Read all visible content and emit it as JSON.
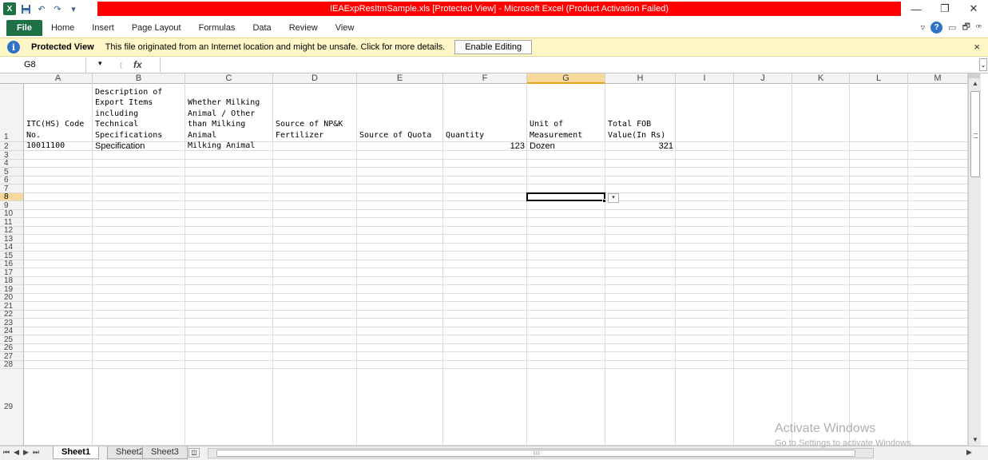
{
  "titlebar": {
    "title": "IEAExpResItmSample.xls  [Protected View]  -  Microsoft Excel (Product Activation Failed)",
    "qat_icons": [
      "excel-logo-icon",
      "save-icon",
      "undo-icon",
      "redo-icon",
      "customize-icon"
    ],
    "controls": {
      "minimize": "—",
      "restore": "❐",
      "close": "✕"
    },
    "title_bg": "#ff0000"
  },
  "ribbon": {
    "tabs": [
      "File",
      "Home",
      "Insert",
      "Page Layout",
      "Formulas",
      "Data",
      "Review",
      "View"
    ],
    "file_color": "#1e7145",
    "right": {
      "minimize_ribbon": "▿",
      "help": "?",
      "win_min": "▭",
      "win_restore": "🗗",
      "win_close": "ꟹ"
    }
  },
  "protected_view": {
    "title": "Protected View",
    "message": "This file originated from an Internet location and might be unsafe. Click for more details.",
    "enable_button": "Enable Editing",
    "close": "×",
    "bg": "#fff7c8"
  },
  "formula_bar": {
    "name_box": "G8",
    "name_arrow": "▾",
    "cancel": "(",
    "fx": "fx",
    "value": "",
    "expand": "⌄"
  },
  "columns": [
    "A",
    "B",
    "C",
    "D",
    "E",
    "F",
    "G",
    "H",
    "I",
    "J",
    "K",
    "L",
    "M"
  ],
  "selected_column": "G",
  "rows": [
    "1",
    "2",
    "3",
    "4",
    "5",
    "6",
    "7",
    "8",
    "9",
    "10",
    "11",
    "12",
    "13",
    "14",
    "15",
    "16",
    "17",
    "18",
    "19",
    "20",
    "21",
    "22",
    "23",
    "24",
    "25",
    "26",
    "27",
    "28",
    "29"
  ],
  "selected_row": "8",
  "header_cells": {
    "A": [
      "ITC(HS) Code",
      "No."
    ],
    "B": [
      "Description of",
      "Export Items",
      "including",
      "Technical",
      "Specifications"
    ],
    "C": [
      "Whether Milking",
      "Animal / Other",
      "than Milking",
      "Animal"
    ],
    "D": [
      "Source of NP&K",
      "Fertilizer"
    ],
    "E": [
      "Source of Quota"
    ],
    "F": [
      "Quantity"
    ],
    "G": [
      "Unit of",
      "Measurement"
    ],
    "H": [
      "Total FOB",
      "Value(In Rs)"
    ]
  },
  "data_row": {
    "A": "10011100",
    "B": "Specification",
    "C": "Milking Animal",
    "F": "123",
    "G": "Dozen",
    "H": "321"
  },
  "dropdown_arrow": "▾",
  "sheet_tabs": {
    "nav": [
      "⏮",
      "◀",
      "▶",
      "⏭"
    ],
    "tabs": [
      "Sheet1",
      "Sheet2",
      "Sheet3"
    ],
    "active": "Sheet1",
    "insert": "◫"
  },
  "scrollbar": {
    "grip": "III",
    "up": "▲",
    "down": "▼",
    "left": "◀",
    "right": "▶"
  },
  "watermark": {
    "title": "Activate Windows",
    "subtitle": "Go to Settings to activate Windows."
  }
}
